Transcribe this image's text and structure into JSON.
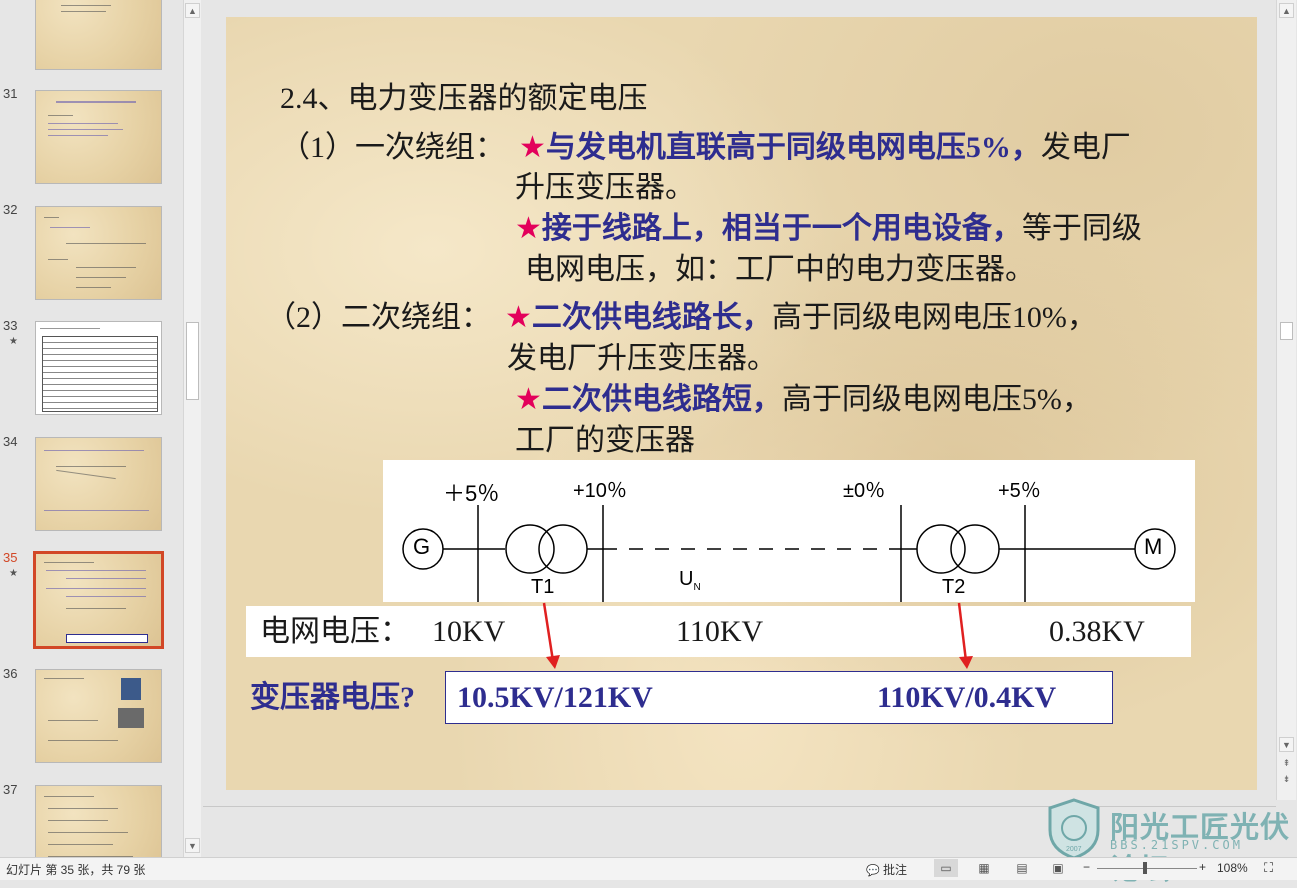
{
  "thumbnails": [
    {
      "number": "31",
      "star": ""
    },
    {
      "number": "32",
      "star": ""
    },
    {
      "number": "33",
      "star": "★"
    },
    {
      "number": "34",
      "star": ""
    },
    {
      "number": "35",
      "star": "★"
    },
    {
      "number": "36",
      "star": ""
    },
    {
      "number": "37",
      "star": ""
    }
  ],
  "slide": {
    "title": "2.4、电力变压器的额定电压",
    "primary": {
      "label": "（1）一次绕组：",
      "star": "★",
      "item1_emph": "与发电机直联高于同级电网电压5%，",
      "item1_rest": "发电厂",
      "item1_line2": "升压变压器。",
      "item2_emph": "接于线路上，相当于一个用电设备，",
      "item2_rest": "等于同级",
      "item2_line2": "电网电压，如：工厂中的电力变压器。"
    },
    "secondary": {
      "label": "（2）二次绕组：",
      "star": "★",
      "item1_emph": "二次供电线路长，",
      "item1_rest": "高于同级电网电压10%，",
      "item1_line2": "发电厂升压变压器。",
      "item2_emph": "二次供电线路短，",
      "item2_rest": "高于同级电网电压5%，",
      "item2_line2": "工厂的变压器"
    },
    "diagram": {
      "pct1": "＋5％",
      "pct2": "+10％",
      "pct3": "±0％",
      "pct4": "+5％",
      "gen": "G",
      "motor": "M",
      "t1": "T1",
      "t2": "T2",
      "un_main": "U",
      "un_sub": "N"
    },
    "grid_label": "电网电压：",
    "grid_v1": "10KV",
    "grid_v2": "110KV",
    "grid_v3": "0.38KV",
    "xf_question": "变压器电压?",
    "xf_v1": "10.5KV/121KV",
    "xf_v2": "110KV/0.4KV"
  },
  "status": {
    "slide_info": "幻灯片 第 35 张，共 79 张",
    "comments": "批注",
    "zoom": "108%"
  },
  "watermark": {
    "name": "阳光工匠光伏论坛",
    "url": "BBS.21SPV.COM",
    "year": "2007"
  },
  "colors": {
    "accent_selected": "#d24726",
    "emphasis_text": "#2e2d8f",
    "star": "#e3005b",
    "arrow": "#e02020"
  }
}
